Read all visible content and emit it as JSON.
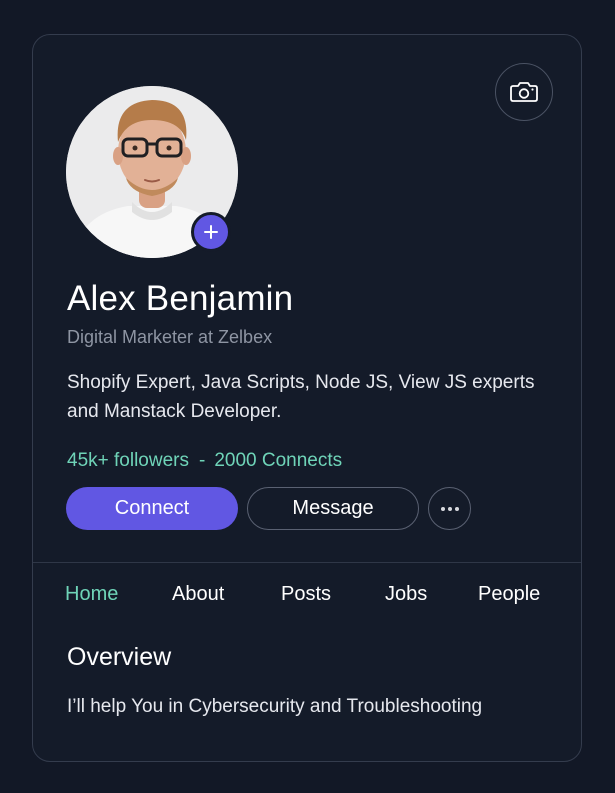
{
  "profile": {
    "name": "Alex Benjamin",
    "headline": "Digital Marketer at Zelbex",
    "bio": "Shopify Expert, Java Scripts, Node JS, View JS experts and Manstack Developer.",
    "followers": "45k+ followers",
    "separator": "-",
    "connects": "2000 Connects"
  },
  "actions": {
    "connect_label": "Connect",
    "message_label": "Message",
    "more_icon": "more-horizontal-icon"
  },
  "icons": {
    "camera": "camera-icon",
    "add_photo": "plus-icon"
  },
  "tabs": [
    {
      "label": "Home",
      "active": true
    },
    {
      "label": "About",
      "active": false
    },
    {
      "label": "Posts",
      "active": false
    },
    {
      "label": "Jobs",
      "active": false
    },
    {
      "label": "People",
      "active": false
    }
  ],
  "overview": {
    "title": "Overview",
    "text": "I’ll help You in Cybersecurity and Troubleshooting"
  },
  "colors": {
    "background": "#121826",
    "card": "#141b29",
    "accent": "#6157e3",
    "highlight": "#6fd4b8"
  }
}
